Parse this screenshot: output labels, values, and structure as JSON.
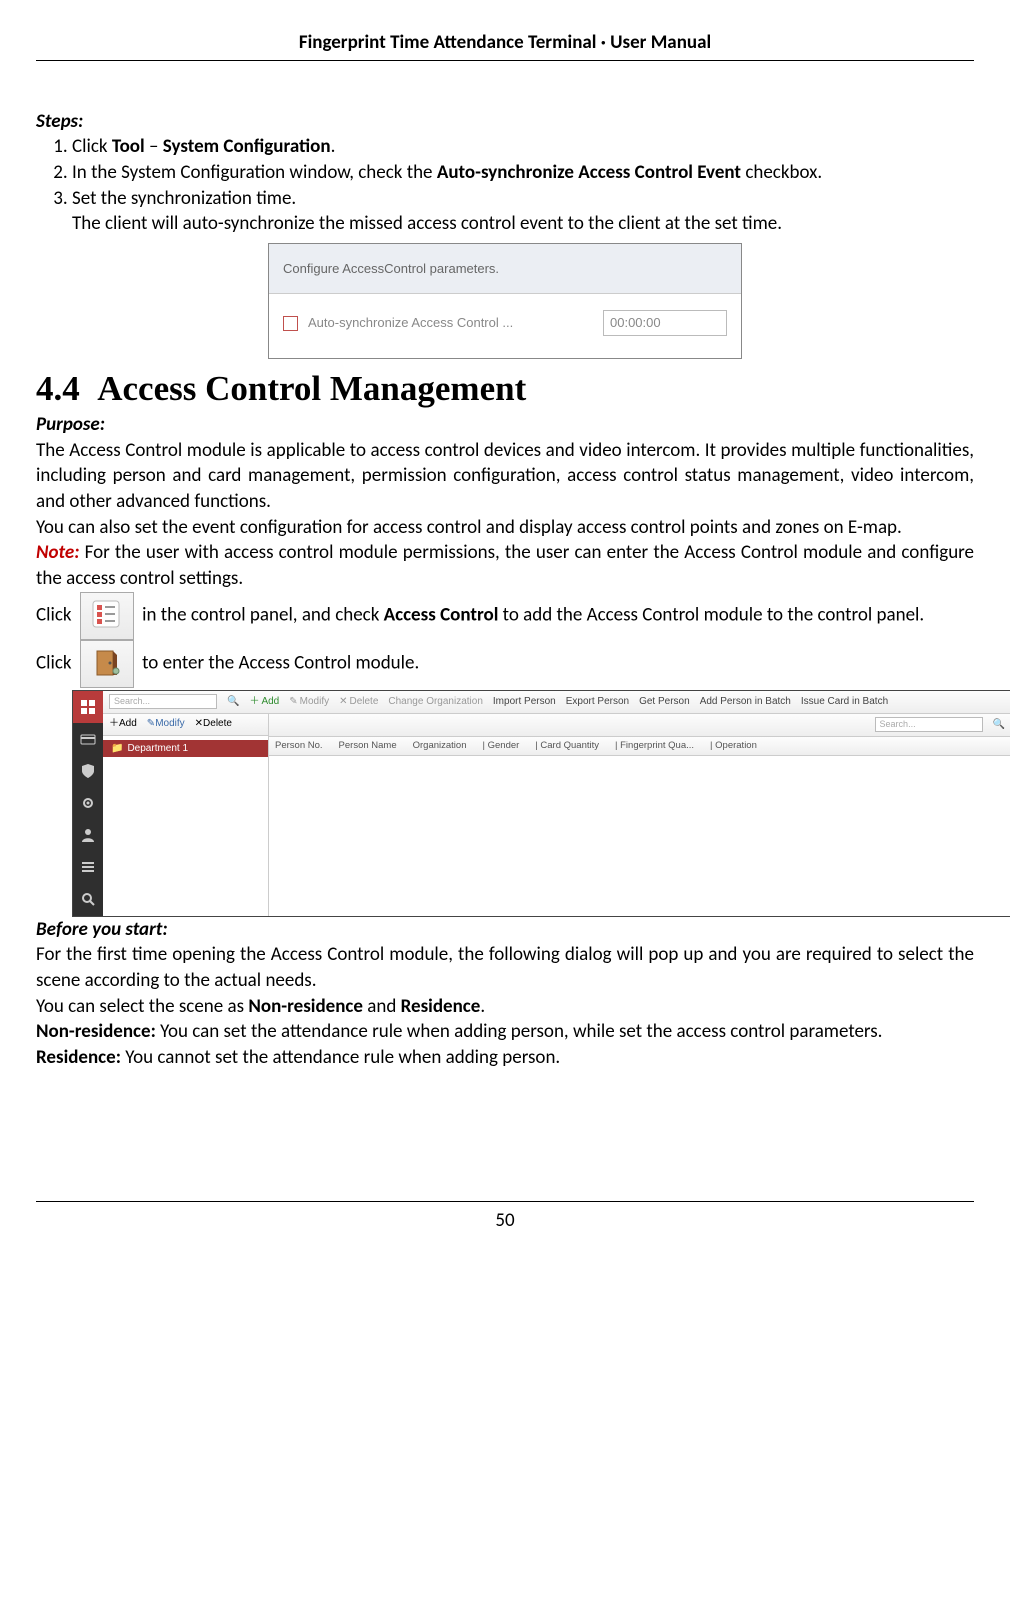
{
  "header": "Fingerprint Time Attendance Terminal · User Manual",
  "steps_label": "Steps:",
  "steps": [
    {
      "prefix": "Click ",
      "b1": "Tool",
      "mid": " – ",
      "b2": "System Configuration",
      "suffix": "."
    },
    {
      "prefix": "In the System Configuration window, check the ",
      "b1": "Auto-synchronize Access Control Event",
      "suffix": " checkbox."
    },
    {
      "line1": "Set the synchronization time.",
      "line2": "The client will auto-synchronize the missed access control event to the client at the set time."
    }
  ],
  "shot1": {
    "title": "Configure AccessControl parameters.",
    "checkbox_label": "Auto-synchronize Access Control ...",
    "time": "00:00:00"
  },
  "section_num": "4.4",
  "section_title": "Access Control Management",
  "purpose_label": "Purpose:",
  "purpose_p1": "The Access Control module is applicable to access control devices and video intercom. It provides multiple functionalities, including person and card management, permission configuration, access control status management, video intercom, and other advanced functions.",
  "purpose_p2": "You can also set the event configuration for access control and display access control points and zones on E-map.",
  "note_label": "Note:",
  "note_text": " For the user with access control module permissions, the user can enter the Access Control module and configure the access control settings.",
  "click1_pre": "Click ",
  "click1_mid": " in the control panel, and check ",
  "click1_bold": "Access Control",
  "click1_post": " to add the Access Control module to the control panel.",
  "click2_pre": "Click ",
  "click2_post": "  to enter the Access Control module.",
  "shot2": {
    "search_placeholder": "Search...",
    "toolbar1": {
      "add": "Add",
      "modify": "Modify",
      "delete": "Delete",
      "change_org": "Change Organization",
      "import": "Import Person",
      "export": "Export Person",
      "get": "Get Person",
      "add_batch": "Add Person in Batch",
      "issue": "Issue Card in Batch"
    },
    "toolbar_tree": {
      "add": "Add",
      "modify": "Modify",
      "delete": "Delete"
    },
    "dept": "Department 1",
    "columns": [
      "Person No.",
      "Person Name",
      "Organization",
      "| Gender",
      "| Card Quantity",
      "| Fingerprint Qua...",
      "| Operation"
    ]
  },
  "before_label": "Before you start:",
  "before_p1": "For the first time opening the Access Control module, the following dialog will pop up and you are required to select the scene according to the actual needs.",
  "before_p2_pre": "You can select the scene as ",
  "before_p2_b1": "Non-residence",
  "before_p2_mid": " and ",
  "before_p2_b2": "Residence",
  "before_p2_end": ".",
  "nonres_label": "Non-residence:",
  "nonres_text": " You can set the attendance rule when adding person, while set the access control parameters.",
  "res_label": "Residence:",
  "res_text": " You cannot set the attendance rule when adding person.",
  "page_num": "50"
}
